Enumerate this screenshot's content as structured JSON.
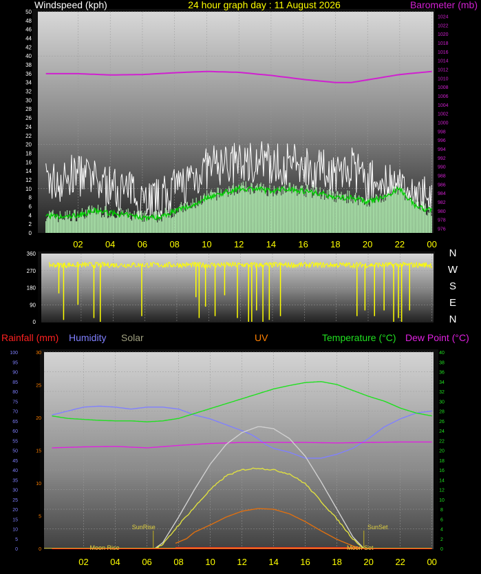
{
  "wind_panel": {
    "left_title": "Windspeed (kph)",
    "center_title": "24 hour graph day : 11 August 2026",
    "right_title": "Barometer (mb)"
  },
  "direction_panel": {
    "compass_labels": [
      "N",
      "W",
      "S",
      "E",
      "N"
    ]
  },
  "weather_panel": {
    "legend": {
      "rainfall": "Rainfall (mm)",
      "humidity": "Humidity",
      "solar": "Solar",
      "uv": "UV",
      "temperature": "Temperature (°C)",
      "dewpoint": "Dew Point (°C)"
    },
    "sunrise": "SunRise",
    "sunset": "SunSet",
    "moonrise": "Moon Rise",
    "moonset": "Moon Set"
  },
  "colors": {
    "windspeed": "#ffffff",
    "avg_wind": "#00cc00",
    "direction": "#ffff00",
    "barometer": "#d020d0",
    "rainfall": "#ff2020",
    "humidity": "#8080ff",
    "solar": "#a0a080",
    "uv": "#ff8000",
    "temperature": "#20e020",
    "dewpoint": "#e020e0",
    "solar_curve": "#e0e040",
    "max_solar": "#d0d0d0",
    "uv_curve": "#e07010"
  },
  "chart_data": [
    {
      "type": "line",
      "title": "24 hour graph day : 11 August 2026",
      "x": [
        "02",
        "04",
        "06",
        "08",
        "10",
        "12",
        "14",
        "16",
        "18",
        "20",
        "22",
        "00"
      ],
      "ylabel": "Windspeed (kph)",
      "ylim": [
        0,
        50
      ],
      "y_ticks": [
        0,
        2,
        4,
        6,
        8,
        10,
        12,
        14,
        16,
        18,
        20,
        22,
        24,
        26,
        28,
        30,
        32,
        34,
        36,
        38,
        40,
        42,
        44,
        46,
        48,
        50
      ],
      "y2label": "Barometer (mb)",
      "y2lim": [
        975,
        1025
      ],
      "y2_ticks": [
        976,
        978,
        980,
        982,
        984,
        986,
        988,
        990,
        992,
        994,
        996,
        998,
        1000,
        1002,
        1004,
        1006,
        1008,
        1010,
        1012,
        1014,
        1016,
        1018,
        1020,
        1022,
        1024
      ],
      "series": [
        {
          "name": "Windspeed (kph)",
          "kind": "gust",
          "x": [
            0,
            1,
            2,
            3,
            4,
            5,
            6,
            7,
            8,
            9,
            10,
            11,
            12,
            13,
            14,
            15,
            16,
            17,
            18,
            19,
            20,
            21,
            22,
            23,
            24
          ],
          "values": [
            12,
            12,
            14,
            12,
            11,
            10,
            9,
            8,
            10,
            13,
            15,
            16,
            16,
            17,
            16,
            16,
            16,
            15,
            14,
            15,
            12,
            12,
            10,
            9,
            9
          ]
        },
        {
          "name": "Average wind",
          "kind": "avg",
          "x": [
            0,
            1,
            2,
            3,
            4,
            5,
            6,
            7,
            8,
            9,
            10,
            11,
            12,
            13,
            14,
            15,
            16,
            17,
            18,
            19,
            20,
            21,
            22,
            23,
            24
          ],
          "values": [
            4,
            3.5,
            4,
            5,
            4.5,
            4,
            3.5,
            3.5,
            5,
            6,
            8,
            9,
            10,
            10,
            9.5,
            10,
            9.5,
            9,
            8,
            8,
            7,
            8,
            10,
            6,
            5
          ]
        },
        {
          "name": "Barometer (mb)",
          "axis": "right",
          "x": [
            0,
            2,
            4,
            6,
            8,
            10,
            12,
            14,
            16,
            18,
            19,
            20,
            22,
            24
          ],
          "values": [
            1011,
            1011,
            1010.7,
            1010.8,
            1011.2,
            1011.5,
            1011.3,
            1010.6,
            1009.7,
            1009,
            1009,
            1009.6,
            1010.8,
            1011.5
          ]
        }
      ]
    },
    {
      "type": "line",
      "title": "",
      "x": [
        "02",
        "04",
        "06",
        "08",
        "10",
        "12",
        "14",
        "16",
        "18",
        "20",
        "22",
        "00"
      ],
      "ylabel": "",
      "ylim": [
        0,
        360
      ],
      "y_ticks": [
        0,
        90,
        180,
        270,
        360
      ],
      "series": [
        {
          "name": "Wind direction",
          "baseline_deg": 300,
          "spread_deg": 15,
          "drops": [
            {
              "hour": 0.6,
              "deg": 150
            },
            {
              "hour": 0.9,
              "deg": 10
            },
            {
              "hour": 1.8,
              "deg": 90
            },
            {
              "hour": 2.8,
              "deg": 20
            },
            {
              "hour": 3.2,
              "deg": 0
            },
            {
              "hour": 5.8,
              "deg": 30
            },
            {
              "hour": 9.2,
              "deg": 130
            },
            {
              "hour": 9.4,
              "deg": 20
            },
            {
              "hour": 9.8,
              "deg": 80
            },
            {
              "hour": 10.4,
              "deg": 30
            },
            {
              "hour": 11.0,
              "deg": 140
            },
            {
              "hour": 11.8,
              "deg": 20
            },
            {
              "hour": 12.5,
              "deg": 0
            },
            {
              "hour": 12.7,
              "deg": 0
            },
            {
              "hour": 13.0,
              "deg": 60
            },
            {
              "hour": 13.4,
              "deg": 0
            },
            {
              "hour": 13.8,
              "deg": 10
            },
            {
              "hour": 14.5,
              "deg": 30
            },
            {
              "hour": 19.3,
              "deg": 30
            },
            {
              "hour": 19.8,
              "deg": 60
            },
            {
              "hour": 20.4,
              "deg": 30
            },
            {
              "hour": 21.0,
              "deg": 60
            },
            {
              "hour": 21.6,
              "deg": 0
            },
            {
              "hour": 21.9,
              "deg": 20
            },
            {
              "hour": 22.1,
              "deg": 0
            },
            {
              "hour": 22.6,
              "deg": 60
            }
          ]
        }
      ]
    },
    {
      "type": "line",
      "title": "",
      "x": [
        "02",
        "04",
        "06",
        "08",
        "10",
        "12",
        "14",
        "16",
        "18",
        "20",
        "22",
        "00"
      ],
      "ylabel": "Humidity",
      "ylim": [
        0,
        100
      ],
      "y_ticks": [
        0,
        5,
        10,
        15,
        20,
        25,
        30,
        35,
        40,
        45,
        50,
        55,
        60,
        65,
        70,
        75,
        80,
        85,
        90,
        95,
        100
      ],
      "y_mid_ticks": [
        0,
        5,
        10,
        15,
        20,
        25,
        30
      ],
      "y2label": "Temperature (°C)",
      "y2lim": [
        0,
        40
      ],
      "y2_ticks": [
        0,
        2,
        4,
        6,
        8,
        10,
        12,
        14,
        16,
        18,
        20,
        22,
        24,
        26,
        28,
        30,
        32,
        34,
        36,
        38,
        40
      ],
      "series": [
        {
          "name": "Humidity",
          "axis": "left",
          "x": [
            0,
            1,
            2,
            3,
            4,
            5,
            6,
            7,
            8,
            9,
            10,
            11,
            12,
            12.6,
            13,
            13.5,
            14,
            15,
            16,
            17,
            18,
            19,
            20,
            21,
            22,
            23,
            24
          ],
          "values": [
            68,
            70,
            72,
            72.5,
            72,
            71,
            72,
            72,
            71,
            68,
            66,
            63,
            60,
            58,
            56,
            53,
            51,
            49,
            46,
            46,
            48,
            51,
            56,
            62,
            66,
            69,
            70
          ]
        },
        {
          "name": "Temperature (°C)",
          "axis": "right",
          "x": [
            0,
            1,
            2,
            3,
            4,
            5,
            6,
            7,
            8,
            9,
            10,
            11,
            12,
            13,
            14,
            15,
            16,
            17,
            18,
            19,
            20,
            21,
            22,
            23,
            24
          ],
          "values": [
            27,
            26.5,
            26.3,
            26.1,
            26,
            26,
            25.8,
            26,
            26.5,
            27.5,
            28.5,
            29.5,
            30.5,
            31.5,
            32.5,
            33.2,
            33.8,
            34,
            33.4,
            32.2,
            31,
            30,
            28.6,
            27.6,
            27
          ]
        },
        {
          "name": "Dew Point (°C)",
          "axis": "right",
          "x": [
            0,
            2,
            4,
            6,
            8,
            10,
            12,
            14,
            16,
            18,
            20,
            22,
            24
          ],
          "values": [
            20.5,
            20.7,
            20.8,
            20.5,
            21,
            21.4,
            21.6,
            21.6,
            21.6,
            21.5,
            21.6,
            21.7,
            21.7
          ]
        },
        {
          "name": "Solar",
          "kind": "max",
          "axis": "left",
          "x": [
            6.5,
            7,
            8,
            9,
            10,
            11,
            12,
            13,
            13.2,
            14,
            15,
            16,
            17,
            18,
            19,
            19.7
          ],
          "values": [
            0,
            3,
            16,
            30,
            43,
            53,
            59,
            62,
            62,
            61,
            56,
            47,
            34,
            20,
            6,
            0
          ]
        },
        {
          "name": "Solar",
          "axis": "left",
          "x": [
            6.5,
            7,
            8,
            9,
            10,
            11,
            12,
            13,
            14,
            15,
            16,
            17,
            18,
            19,
            19.7
          ],
          "values": [
            0,
            2,
            12,
            21,
            30,
            37,
            40,
            41,
            40,
            38,
            33,
            24,
            15,
            5,
            0
          ]
        },
        {
          "name": "UV",
          "axis": "mid",
          "x": [
            7.8,
            8.5,
            9,
            10,
            11,
            12,
            13,
            14,
            15,
            16,
            17,
            18,
            19,
            19.5
          ],
          "values": [
            0.8,
            1.5,
            2.5,
            3.6,
            4.8,
            5.7,
            6.1,
            6.0,
            5.3,
            4.1,
            2.7,
            1.4,
            0.4,
            0
          ]
        },
        {
          "name": "Rainfall (mm)",
          "axis": "mid",
          "x": [
            0,
            24
          ],
          "values": [
            0,
            0
          ]
        }
      ],
      "annotations": [
        {
          "label": "SunRise",
          "hour": 6.4
        },
        {
          "label": "SunSet",
          "hour": 19.7
        },
        {
          "label": "Moon Rise",
          "hour": 0.5
        },
        {
          "label": "Moon Set",
          "hour": 19.2
        }
      ]
    }
  ]
}
